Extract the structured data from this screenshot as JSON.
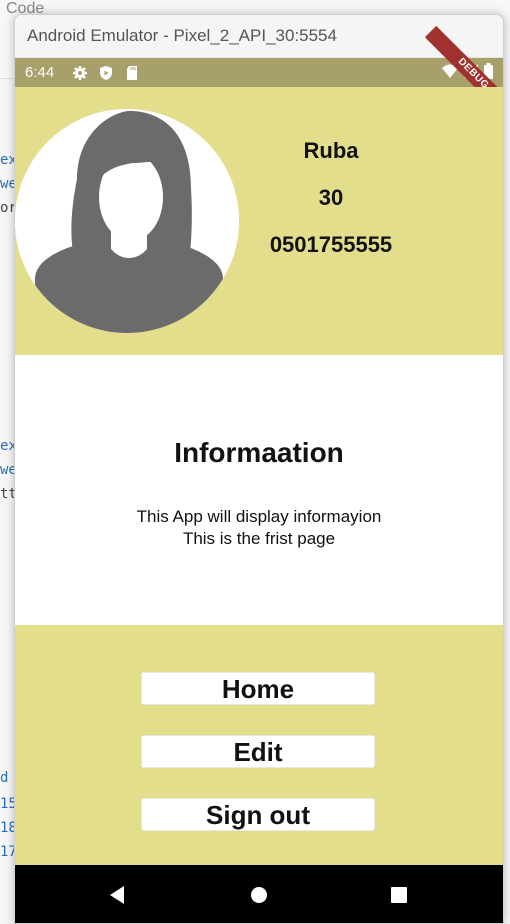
{
  "background": {
    "title": "Code",
    "fragments": [
      "ex",
      "we",
      "or",
      "ex",
      "we",
      "tt",
      "d :",
      "15",
      "18",
      "17"
    ]
  },
  "window": {
    "title": "Android Emulator - Pixel_2_API_30:5554"
  },
  "status_bar": {
    "time": "6:44",
    "left_icons": [
      "gear-icon",
      "play-protect-icon",
      "sd-card-icon"
    ],
    "right_icons": [
      "wifi-icon",
      "signal-icon",
      "battery-icon"
    ],
    "debug_banner": "DEBUG",
    "color": "#a8a06a"
  },
  "profile": {
    "name": "Ruba",
    "age": "30",
    "phone": "0501755555",
    "background_color": "#e3de8b"
  },
  "info": {
    "title": "Informaation",
    "line1": "This App will display informayion",
    "line2": "This is the frist page"
  },
  "buttons": {
    "home": "Home",
    "edit": "Edit",
    "sign_out": "Sign out"
  },
  "nav": [
    "back-icon",
    "home-icon",
    "recents-icon"
  ]
}
